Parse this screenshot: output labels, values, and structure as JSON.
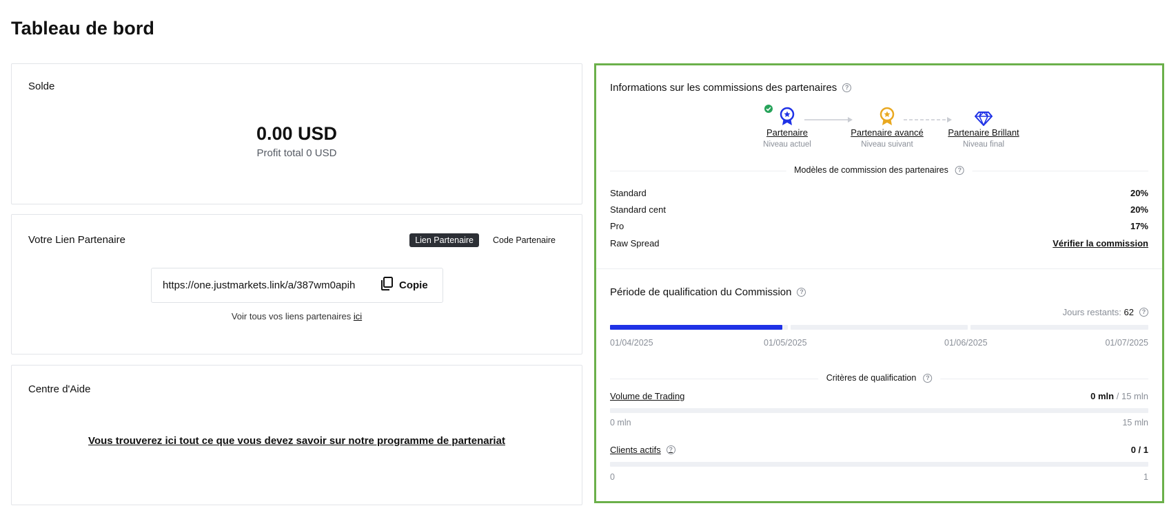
{
  "page": {
    "title": "Tableau de bord"
  },
  "balance": {
    "title": "Solde",
    "amount": "0.00 USD",
    "profit": "Profit total 0 USD"
  },
  "partner_link": {
    "title": "Votre Lien Partenaire",
    "toggle_link_label": "Lien Partenaire",
    "toggle_code_label": "Code Partenaire",
    "url": "https://one.justmarkets.link/a/387wm0apih",
    "copy_label": "Copie",
    "hint_text": "Voir tous vos liens partenaires ",
    "hint_link": "ici"
  },
  "help_center": {
    "title": "Centre d'Aide",
    "link_text": "Vous trouverez ici tout ce que vous devez savoir sur notre programme de partenariat"
  },
  "commission": {
    "title": "Informations sur les commissions des partenaires",
    "levels": [
      {
        "name": "Partenaire",
        "status": "Niveau actuel",
        "icon": "medal-blue-icon"
      },
      {
        "name": "Partenaire avancé",
        "status": "Niveau suivant",
        "icon": "medal-gold-icon"
      },
      {
        "name": "Partenaire Brillant",
        "status": "Niveau final",
        "icon": "diamond-icon"
      }
    ],
    "models_title": "Modèles de commission des partenaires",
    "models": [
      {
        "name": "Standard",
        "value": "20%"
      },
      {
        "name": "Standard cent",
        "value": "20%"
      },
      {
        "name": "Pro",
        "value": "17%"
      },
      {
        "name": "Raw Spread",
        "value": "Vérifier la commission"
      }
    ]
  },
  "qualification": {
    "title": "Période de qualification du Commission",
    "days_label": "Jours restants:",
    "days_value": "62",
    "dates": [
      "01/04/2025",
      "01/05/2025",
      "01/06/2025",
      "01/07/2025"
    ],
    "month_progress": [
      0.97,
      0,
      0
    ],
    "criteria_title": "Critères de qualification",
    "criteria": [
      {
        "name": "Volume de Trading",
        "current": "0 mln",
        "target": "/ 15 mln",
        "min": "0 mln",
        "max": "15 mln",
        "progress": 0
      },
      {
        "name": "Clients actifs",
        "current": "0 / 1",
        "target": "",
        "min": "0",
        "max": "1",
        "progress": 0
      }
    ]
  },
  "colors": {
    "accent_blue": "#1f32e6",
    "gold": "#e9a820",
    "panel_border": "#6bb04a",
    "check_green": "#27a35a"
  }
}
